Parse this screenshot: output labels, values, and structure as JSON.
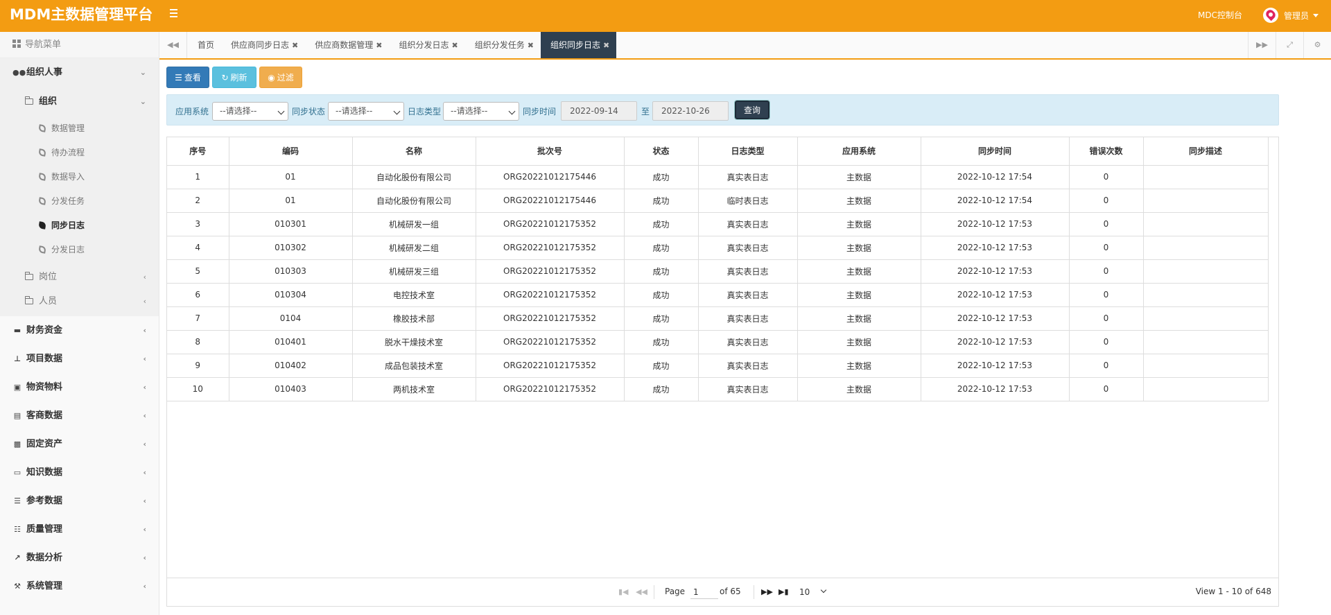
{
  "header": {
    "logo": "MDM主数据管理平台",
    "console_label": "MDC控制台",
    "user_name": "管理员"
  },
  "sidebar": {
    "nav_title": "导航菜单",
    "org_hr": "组织人事",
    "org": "组织",
    "org_items": [
      "数据管理",
      "待办流程",
      "数据导入",
      "分发任务",
      "同步日志",
      "分发日志"
    ],
    "post": "岗位",
    "person": "人员",
    "modules": [
      "财务资金",
      "项目数据",
      "物资物料",
      "客商数据",
      "固定资产",
      "知识数据",
      "参考数据",
      "质量管理",
      "数据分析",
      "系统管理"
    ]
  },
  "tabs": [
    "首页",
    "供应商同步日志",
    "供应商数据管理",
    "组织分发日志",
    "组织分发任务",
    "组织同步日志"
  ],
  "toolbar": {
    "view": "查看",
    "refresh": "刷新",
    "filter": "过滤"
  },
  "filter": {
    "app_label": "应用系统",
    "app_value": "--请选择--",
    "status_label": "同步状态",
    "status_value": "--请选择--",
    "logtype_label": "日志类型",
    "logtype_value": "--请选择--",
    "time_label": "同步时间",
    "date_from": "2022-09-14",
    "to_label": "至",
    "date_to": "2022-10-26",
    "query": "查询"
  },
  "table": {
    "columns": [
      "序号",
      "编码",
      "名称",
      "批次号",
      "状态",
      "日志类型",
      "应用系统",
      "同步时间",
      "错误次数",
      "同步描述"
    ],
    "rows": [
      [
        "1",
        "01",
        "自动化股份有限公司",
        "ORG20221012175446",
        "成功",
        "真实表日志",
        "主数据",
        "2022-10-12 17:54",
        "0",
        ""
      ],
      [
        "2",
        "01",
        "自动化股份有限公司",
        "ORG20221012175446",
        "成功",
        "临时表日志",
        "主数据",
        "2022-10-12 17:54",
        "0",
        ""
      ],
      [
        "3",
        "010301",
        "机械研发一组",
        "ORG20221012175352",
        "成功",
        "真实表日志",
        "主数据",
        "2022-10-12 17:53",
        "0",
        ""
      ],
      [
        "4",
        "010302",
        "机械研发二组",
        "ORG20221012175352",
        "成功",
        "真实表日志",
        "主数据",
        "2022-10-12 17:53",
        "0",
        ""
      ],
      [
        "5",
        "010303",
        "机械研发三组",
        "ORG20221012175352",
        "成功",
        "真实表日志",
        "主数据",
        "2022-10-12 17:53",
        "0",
        ""
      ],
      [
        "6",
        "010304",
        "电控技术室",
        "ORG20221012175352",
        "成功",
        "真实表日志",
        "主数据",
        "2022-10-12 17:53",
        "0",
        ""
      ],
      [
        "7",
        "0104",
        "橡胶技术部",
        "ORG20221012175352",
        "成功",
        "真实表日志",
        "主数据",
        "2022-10-12 17:53",
        "0",
        ""
      ],
      [
        "8",
        "010401",
        "脱水干燥技术室",
        "ORG20221012175352",
        "成功",
        "真实表日志",
        "主数据",
        "2022-10-12 17:53",
        "0",
        ""
      ],
      [
        "9",
        "010402",
        "成品包装技术室",
        "ORG20221012175352",
        "成功",
        "真实表日志",
        "主数据",
        "2022-10-12 17:53",
        "0",
        ""
      ],
      [
        "10",
        "010403",
        "两机技术室",
        "ORG20221012175352",
        "成功",
        "真实表日志",
        "主数据",
        "2022-10-12 17:53",
        "0",
        ""
      ]
    ]
  },
  "pager": {
    "page_label": "Page",
    "page_value": "1",
    "of_label": "of 65",
    "page_size": "10",
    "view_text": "View 1 - 10 of 648"
  },
  "colors": {
    "header": "#f39c12",
    "active_tab": "#2f4050",
    "filter_bg": "#d9edf7"
  }
}
